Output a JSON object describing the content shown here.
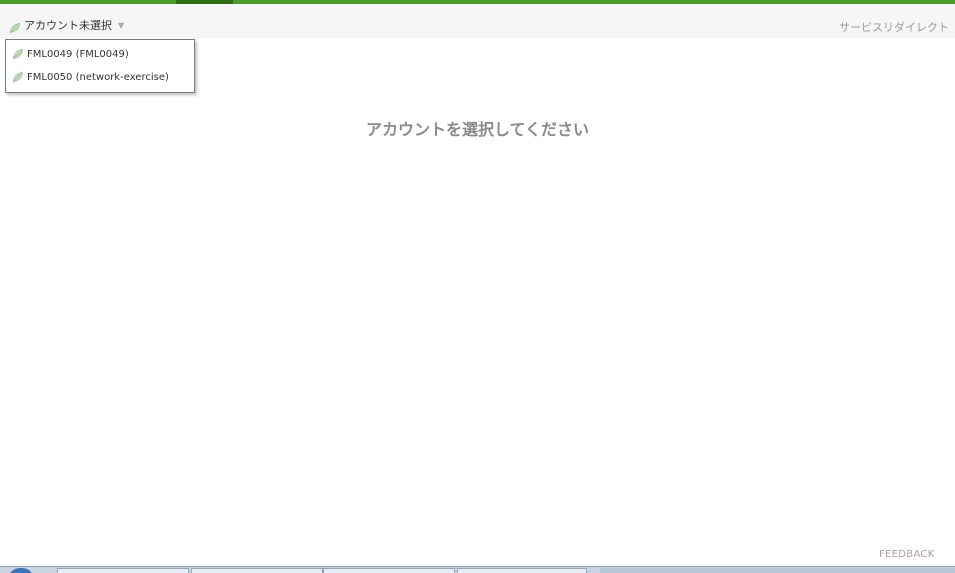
{
  "header": {
    "account_selector_label": "アカウント未選択",
    "caret": "▼",
    "service_redirect": "サービスリダイレクト"
  },
  "dropdown": {
    "items": [
      {
        "label": "FML0049 (FML0049)",
        "icon": "leaf-icon"
      },
      {
        "label": "FML0050 (network-exercise)",
        "icon": "leaf-icon"
      }
    ]
  },
  "main": {
    "message": "アカウントを選択してください"
  },
  "footer": {
    "feedback": "FEEDBACK"
  },
  "colors": {
    "accent": "#4a9a2c",
    "accent_dark": "#2d6b17",
    "message_gray": "#8a8a8a"
  }
}
